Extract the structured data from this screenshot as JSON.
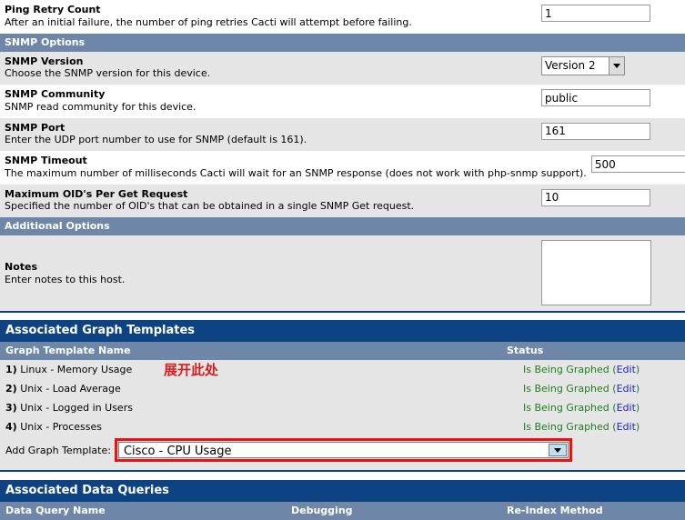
{
  "colors": {
    "section_header_dark": "#0d4382",
    "section_header_light": "#6e87a8",
    "row_alt": "#e5e5e5",
    "row_norm": "#ffffff",
    "status_green": "#1f7d1f",
    "link_blue": "#2222cc",
    "annotation_red": "#d22020",
    "highlight_box_red": "#ee1111",
    "dropdown_button_blue": "#bfe0f0"
  },
  "fields": {
    "ping_retry_count": {
      "name": "Ping Retry Count",
      "description": "After an initial failure, the number of ping retries Cacti will attempt before failing.",
      "value": "1"
    },
    "snmp_version": {
      "name": "SNMP Version",
      "description": "Choose the SNMP version for this device.",
      "value": "Version 2"
    },
    "snmp_community": {
      "name": "SNMP Community",
      "description": "SNMP read community for this device.",
      "value": "public"
    },
    "snmp_port": {
      "name": "SNMP Port",
      "description": "Enter the UDP port number to use for SNMP (default is 161).",
      "value": "161"
    },
    "snmp_timeout": {
      "name": "SNMP Timeout",
      "description": "The maximum number of milliseconds Cacti will wait for an SNMP response (does not work with php-snmp support).",
      "value": "500"
    },
    "max_oids": {
      "name": "Maximum OID's Per Get Request",
      "description": "Specified the number of OID's that can be obtained in a single SNMP Get request.",
      "value": "10"
    },
    "notes": {
      "name": "Notes",
      "description": "Enter notes to this host.",
      "value": "",
      "placeholder": ""
    }
  },
  "sections": {
    "snmp_options": "SNMP Options",
    "additional_options": "Additional Options",
    "associated_graph_templates": "Associated Graph Templates",
    "associated_data_queries": "Associated Data Queries"
  },
  "graph_templates": {
    "column_headers": {
      "name": "Graph Template Name",
      "status": "Status"
    },
    "rows": [
      {
        "index": "1)",
        "name": "Linux - Memory Usage",
        "status": "Is Being Graphed",
        "action": "Edit"
      },
      {
        "index": "2)",
        "name": "Unix - Load Average",
        "status": "Is Being Graphed",
        "action": "Edit"
      },
      {
        "index": "3)",
        "name": "Unix - Logged in Users",
        "status": "Is Being Graphed",
        "action": "Edit"
      },
      {
        "index": "4)",
        "name": "Unix - Processes",
        "status": "Is Being Graphed",
        "action": "Edit"
      }
    ],
    "add_label": "Add Graph Template:",
    "add_selected": "Cisco - CPU Usage"
  },
  "data_queries": {
    "column_headers": {
      "name": "Data Query Name",
      "debugging": "Debugging",
      "reindex": "Re-Index Method"
    }
  },
  "annotation": {
    "text": "展开此处"
  }
}
